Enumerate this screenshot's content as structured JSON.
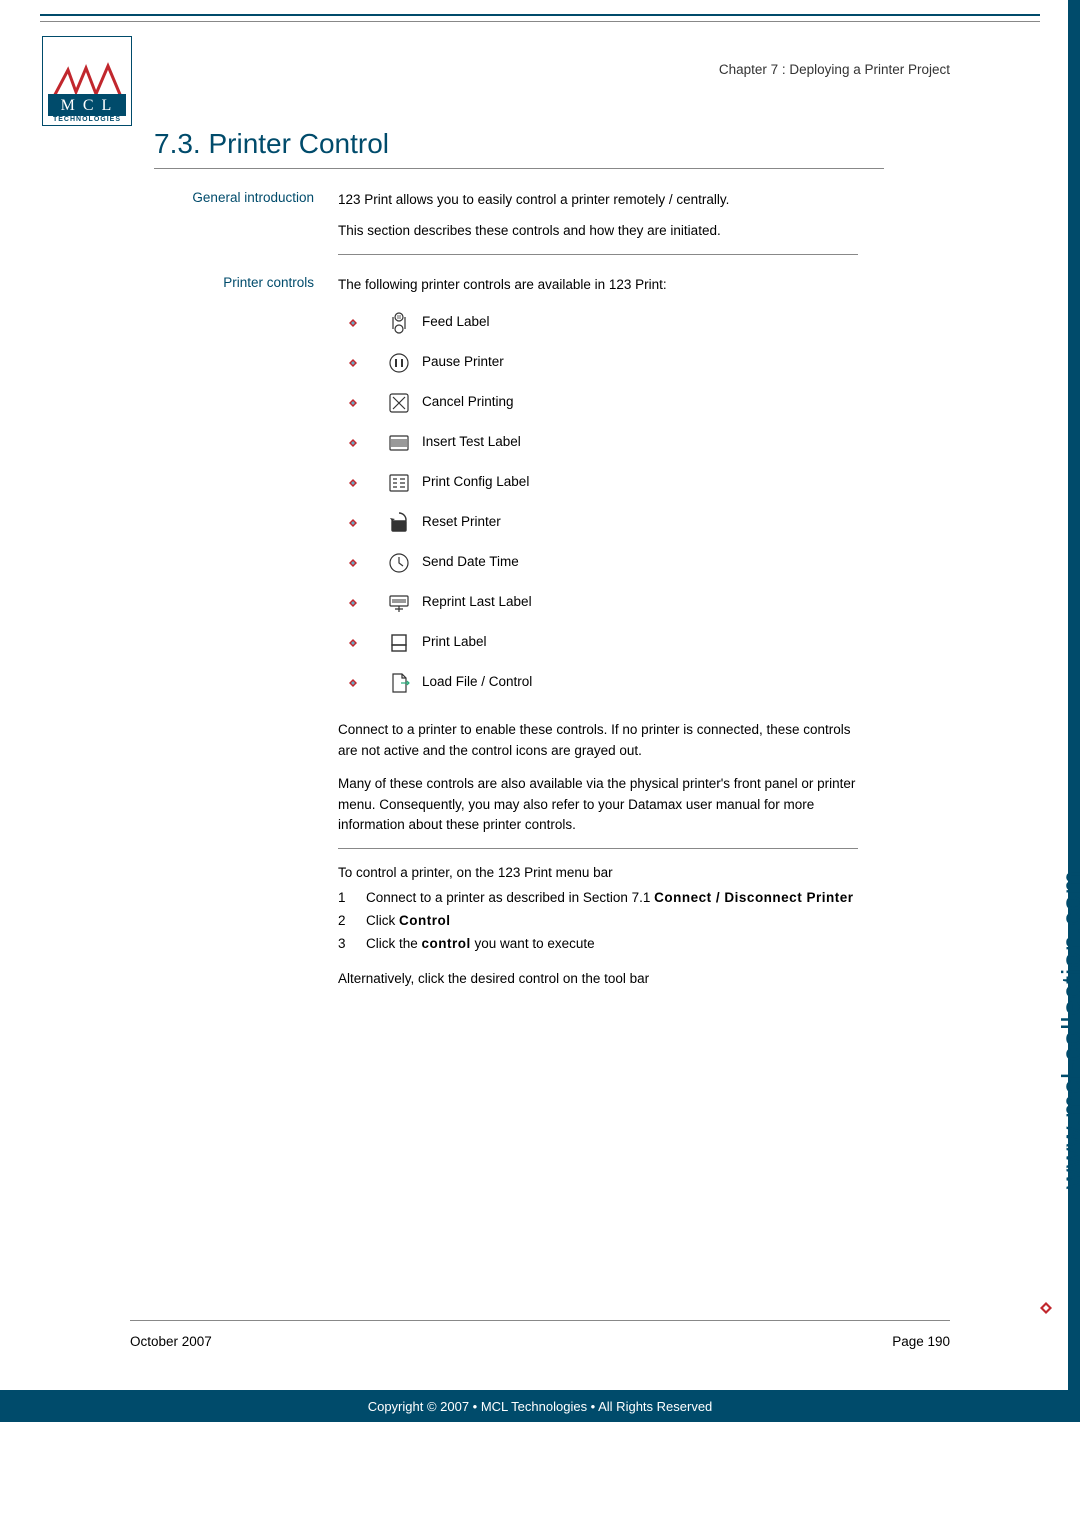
{
  "header": {
    "chapter": "Chapter 7 : Deploying a Printer Project"
  },
  "logo": {
    "line1": "M C L",
    "line2": "TECHNOLOGIES"
  },
  "section": {
    "number": "7.3.",
    "title": "Printer Control"
  },
  "intro": {
    "label": "General introduction",
    "p1": "123 Print allows you to easily control a printer remotely / centrally.",
    "p2": "This section describes these controls and how they are initiated."
  },
  "controls": {
    "label": "Printer controls",
    "lead": "The following printer controls are available in 123 Print:",
    "items": [
      {
        "icon": "feed-label-icon",
        "text": "Feed Label"
      },
      {
        "icon": "pause-printer-icon",
        "text": "Pause Printer"
      },
      {
        "icon": "cancel-printing-icon",
        "text": "Cancel Printing"
      },
      {
        "icon": "insert-test-label-icon",
        "text": "Insert Test Label"
      },
      {
        "icon": "print-config-icon",
        "text": "Print Config Label"
      },
      {
        "icon": "reset-printer-icon",
        "text": "Reset Printer"
      },
      {
        "icon": "send-datetime-icon",
        "text": "Send Date Time"
      },
      {
        "icon": "reprint-label-icon",
        "text": "Reprint Last Label"
      },
      {
        "icon": "print-label-icon",
        "text": "Print Label"
      },
      {
        "icon": "load-file-icon",
        "text": "Load File / Control"
      }
    ],
    "note1": "Connect to a printer to enable these controls. If no printer is connected, these controls are not active and the control icons are grayed out.",
    "note2": "Many of these controls are also available via the physical printer's front panel or printer menu. Consequently, you may also refer to your Datamax user manual for more information about these printer controls."
  },
  "steps": {
    "lead": "To control a printer, on the 123 Print menu bar",
    "items": [
      {
        "n": "1",
        "pre": "Connect to a printer as described in Section 7.1 ",
        "bold": "Connect / Disconnect Printer",
        "post": ""
      },
      {
        "n": "2",
        "pre": "Click ",
        "bold": "Control",
        "post": ""
      },
      {
        "n": "3",
        "pre": "Click the ",
        "bold": "control",
        "post": " you want to execute"
      }
    ],
    "alt": "Alternatively, click the desired control on the tool bar"
  },
  "footer": {
    "date": "October 2007",
    "page": "Page 190",
    "copyright": "Copyright © 2007 • MCL Technologies • All Rights Reserved"
  },
  "side": {
    "url": "www.mcl-collection.com"
  }
}
